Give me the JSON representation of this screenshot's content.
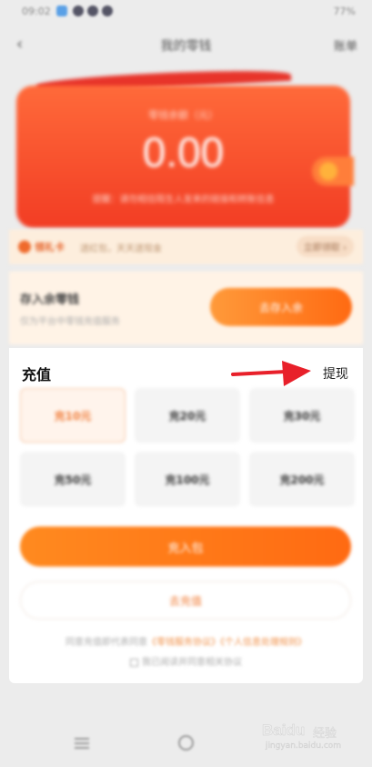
{
  "status_bar": {
    "time": "09:02",
    "right": "77%"
  },
  "nav": {
    "title": "我的零钱",
    "right_label": "账单"
  },
  "wallet": {
    "label": "零钱余额（元）",
    "balance": "0.00",
    "note": "提醒：请勿相信陌生人发来的链接和转账信息"
  },
  "promo": {
    "tag": "领礼卡",
    "text": "送红包，天天送现金",
    "link": "立即领取 ›"
  },
  "deposit": {
    "title": "存入余零钱",
    "subtitle": "仅为平台中零钱充值服务",
    "button": "去存入余"
  },
  "recharge": {
    "title": "充值",
    "withdraw_label": "提现",
    "options": [
      "充10元",
      "充20元",
      "充30元",
      "充50元",
      "充100元",
      "充200元"
    ],
    "selected_index": 0,
    "pay_button": "充入包",
    "alt_button": "去充值",
    "agreement_prefix": "同意充值即代表同意",
    "agreement_link_1": "《零钱服务协议》",
    "agreement_link_2": "《个人信息处理规则》",
    "agreement_check": "我已阅读并同意相关协议"
  },
  "watermark": {
    "brand": "Baidu",
    "cn": "经验",
    "url": "jingyan.baidu.com"
  },
  "colors": {
    "accent": "#ff6a12",
    "wallet_red": "#f23d24",
    "arrow_red": "#e8202a"
  }
}
